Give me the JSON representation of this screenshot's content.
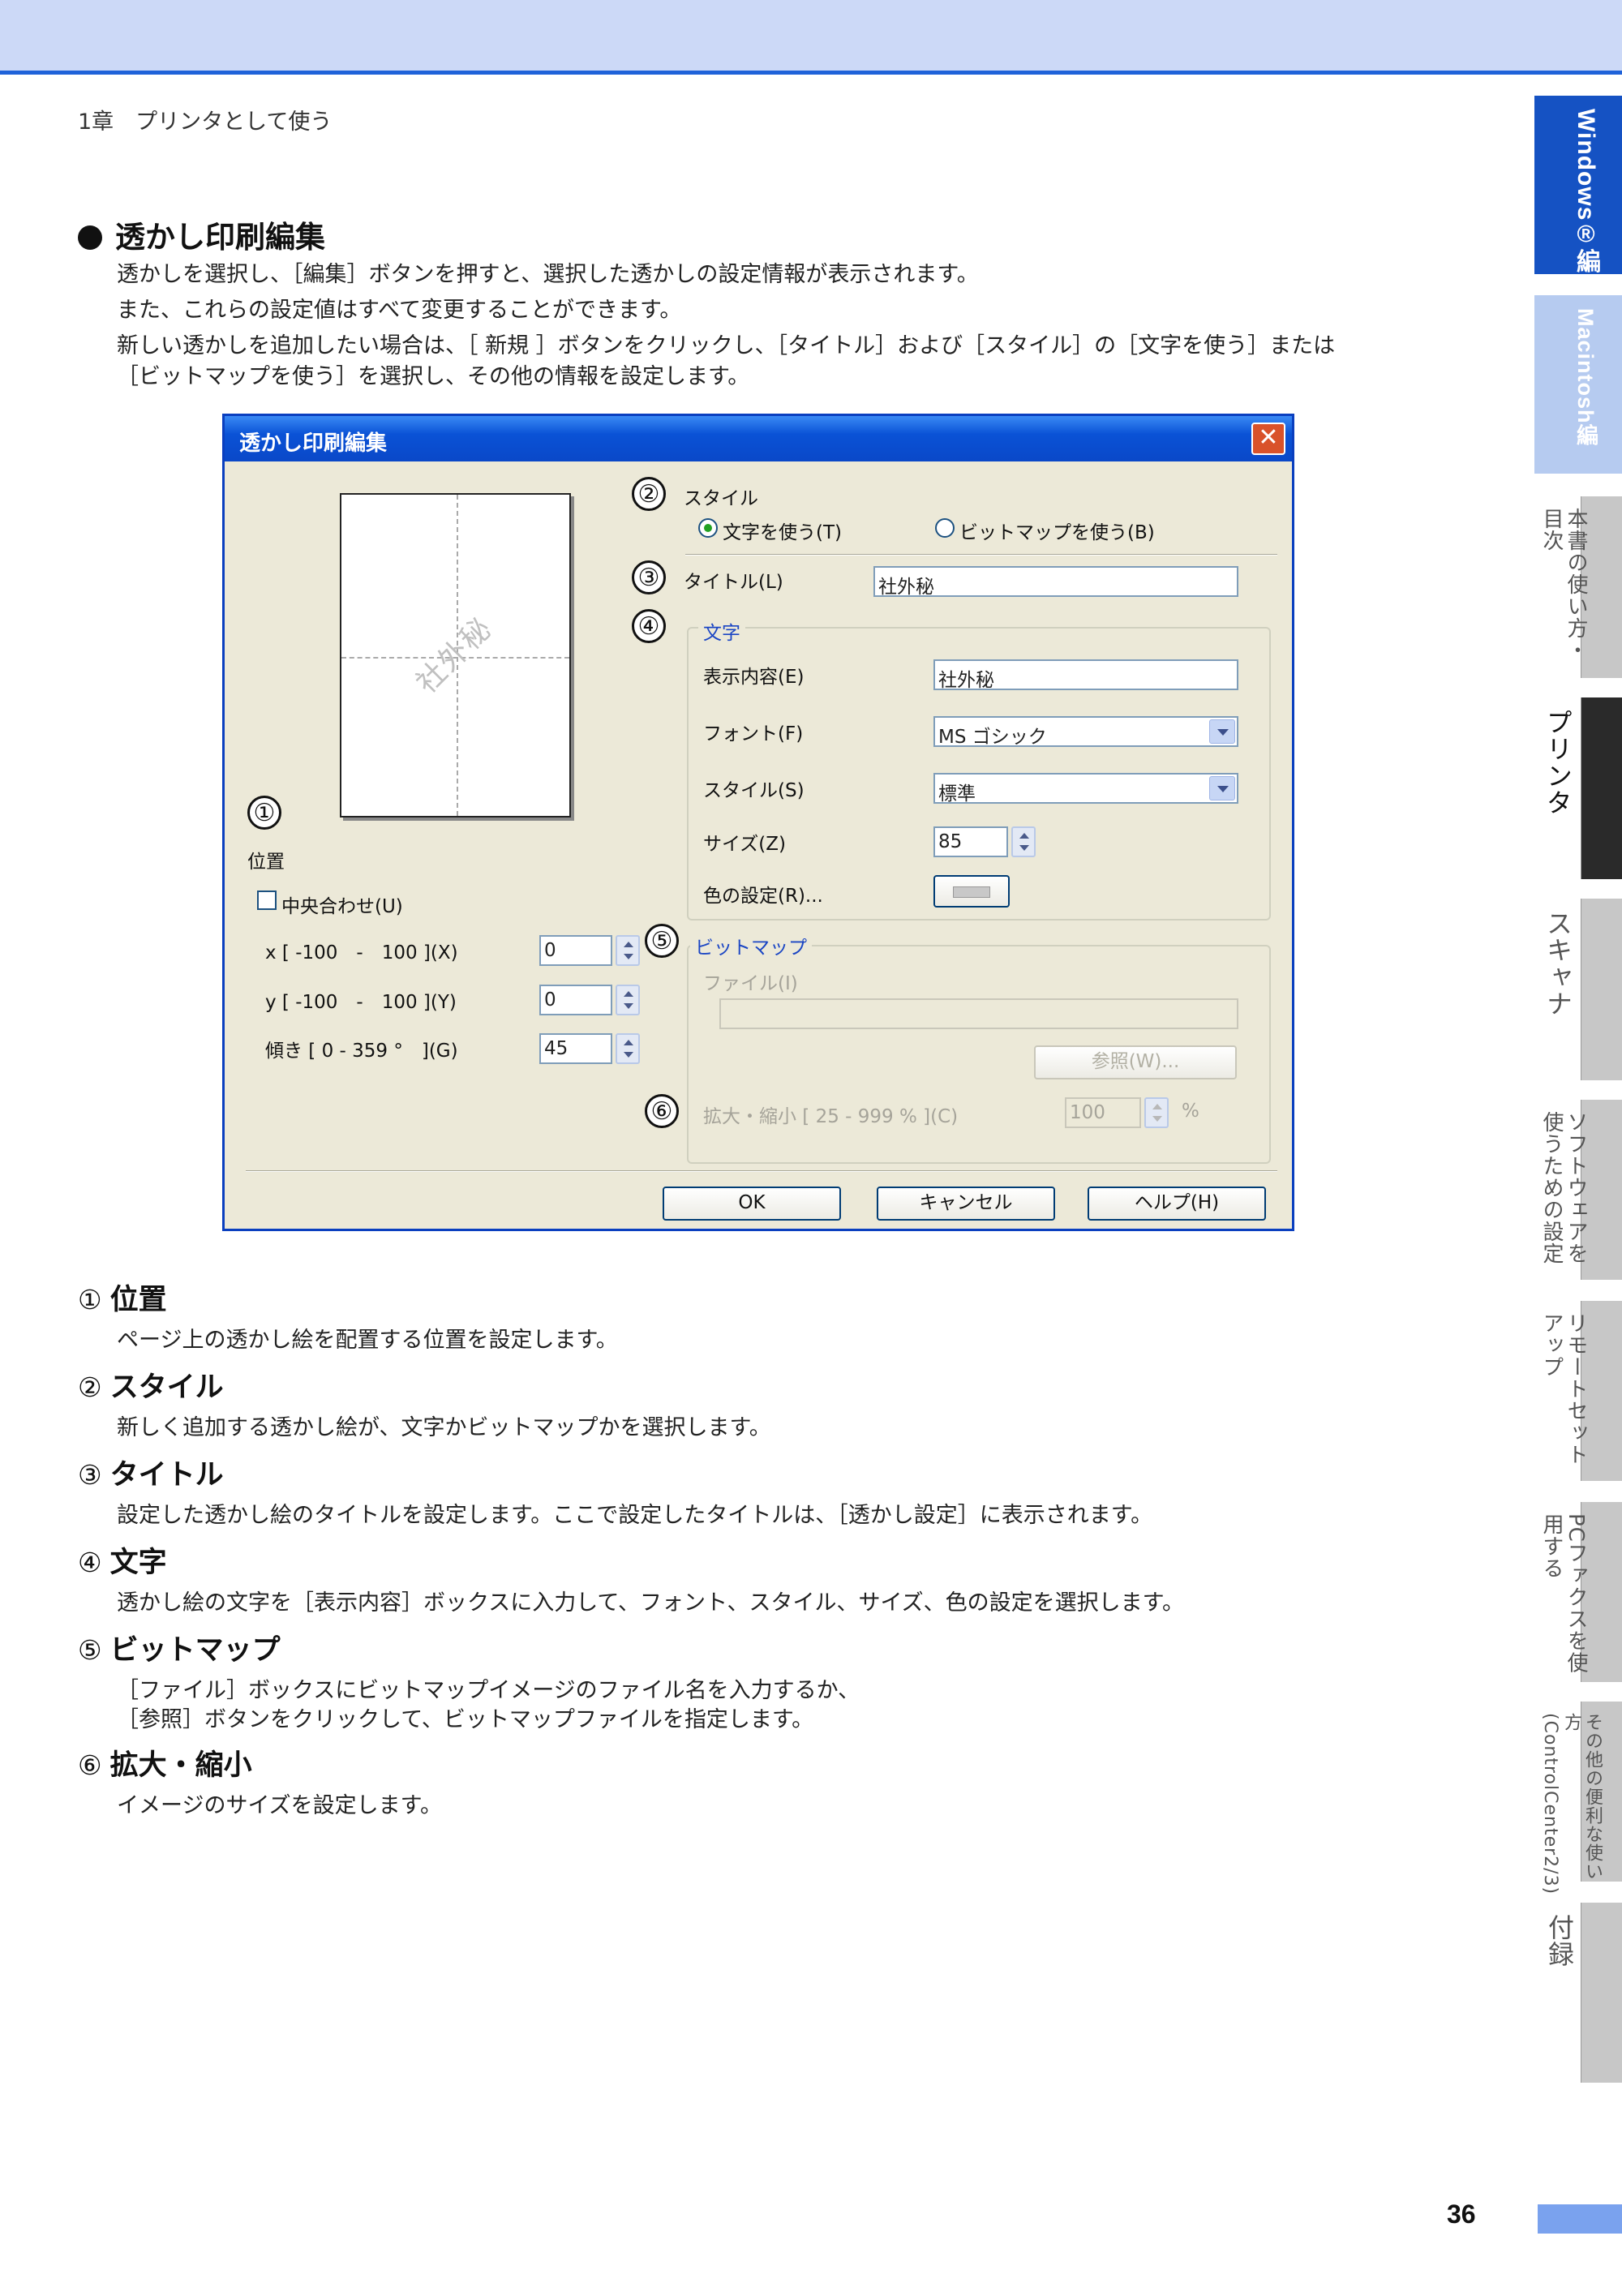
{
  "header": {
    "chapter": "1章　プリンタとして使う"
  },
  "section": {
    "title": "透かし印刷編集",
    "intro": [
      "透かしを選択し、［編集］ボタンを押すと、選択した透かしの設定情報が表示されます。",
      "また、これらの設定値はすべて変更することができます。",
      "新しい透かしを追加したい場合は、［ 新規 ］ボタンをクリックし、［タイトル］および［スタイル］の［文字を使う］または",
      "［ビットマップを使う］を選択し、その他の情報を設定します。"
    ]
  },
  "dialog": {
    "title": "透かし印刷編集",
    "close_label": "✕",
    "callouts": [
      "①",
      "②",
      "③",
      "④",
      "⑤",
      "⑥"
    ],
    "preview_watermark": "社外秘",
    "position_label": "位置",
    "center_label": "中央合わせ(U)",
    "x_label": "x [ -100　-　100 ](X)",
    "x_value": "0",
    "y_label": "y [ -100　-　100 ](Y)",
    "y_value": "0",
    "tilt_label": "傾き [ 0 - 359 °　](G)",
    "tilt_value": "45",
    "style_label": "スタイル",
    "style_text_option": "文字を使う(T)",
    "style_bitmap_option": "ビットマップを使う(B)",
    "title_field_label": "タイトル(L)",
    "title_value": "社外秘",
    "text_group_label": "文字",
    "display_content_label": "表示内容(E)",
    "display_content_value": "社外秘",
    "font_label": "フォント(F)",
    "font_value": "MS ゴシック",
    "style2_label": "スタイル(S)",
    "style2_value": "標準",
    "size_label": "サイズ(Z)",
    "size_value": "85",
    "color_label": "色の設定(R)...",
    "bitmap_group_label": "ビットマップ",
    "file_label": "ファイル(I)",
    "file_value": "",
    "browse_label": "参照(W)...",
    "scale_label": "拡大・縮小 [ 25 - 999 % ](C)",
    "scale_value": "100",
    "scale_unit": "%",
    "ok_label": "OK",
    "cancel_label": "キャンセル",
    "help_label": "ヘルプ(H)"
  },
  "descriptions": [
    {
      "num": "①",
      "title": "位置",
      "text": [
        "ページ上の透かし絵を配置する位置を設定します。"
      ]
    },
    {
      "num": "②",
      "title": "スタイル",
      "text": [
        "新しく追加する透かし絵が、文字かビットマップかを選択します。"
      ]
    },
    {
      "num": "③",
      "title": "タイトル",
      "text": [
        "設定した透かし絵のタイトルを設定します。ここで設定したタイトルは、［透かし設定］に表示されます。"
      ]
    },
    {
      "num": "④",
      "title": "文字",
      "text": [
        "透かし絵の文字を［表示内容］ボックスに入力して、フォント、スタイル、サイズ、色の設定を選択します。"
      ]
    },
    {
      "num": "⑤",
      "title": "ビットマップ",
      "text": [
        "［ファイル］ボックスにビットマップイメージのファイル名を入力するか、",
        "［参照］ボタンをクリックして、ビットマップファイルを指定します。"
      ]
    },
    {
      "num": "⑥",
      "title": "拡大・縮小",
      "text": [
        "イメージのサイズを設定します。"
      ]
    }
  ],
  "side_tabs": [
    {
      "label": "Windows®編"
    },
    {
      "label": "Macintosh編"
    },
    {
      "label": "本書の使い方・目次"
    },
    {
      "label": "プリンタ"
    },
    {
      "label": "スキャナ"
    },
    {
      "label": "ソフトウェアを使うための設定"
    },
    {
      "label": "リモートセットアップ"
    },
    {
      "label": "PCファクスを使用する"
    },
    {
      "label": "その他の便利な使い方(ControlCenter2/3)"
    },
    {
      "label": "付録"
    }
  ],
  "page_number": "36",
  "colors": {
    "accent": "#1f62d9",
    "header_band": "#ccd9f7",
    "dialog_title": "#0a52d6"
  }
}
